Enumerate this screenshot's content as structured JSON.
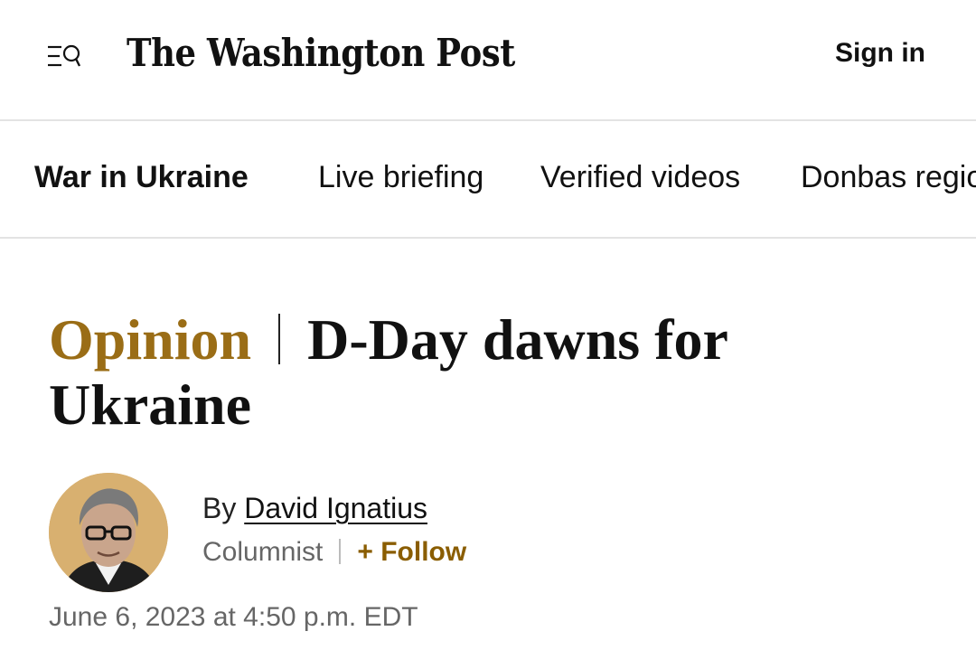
{
  "header": {
    "menu_icon": "menu-search-icon",
    "logo_text": "The Washington Post",
    "sign_in_label": "Sign in"
  },
  "section_nav": {
    "items": [
      {
        "label": "War in Ukraine",
        "active": true
      },
      {
        "label": "Live briefing",
        "active": false
      },
      {
        "label": "Verified videos",
        "active": false
      },
      {
        "label": "Donbas region",
        "active": false
      }
    ]
  },
  "article": {
    "kicker": "Opinion",
    "title": "D-Day dawns for Ukraine",
    "byline_prefix": "By",
    "author": "David Ignatius",
    "role": "Columnist",
    "follow_label": "+ Follow",
    "date": "June 6, 2023 at 4:50 p.m. EDT"
  },
  "colors": {
    "opinion_accent": "#9a6d16",
    "follow_accent": "#8a5d00",
    "avatar_bg": "#d8b070"
  }
}
